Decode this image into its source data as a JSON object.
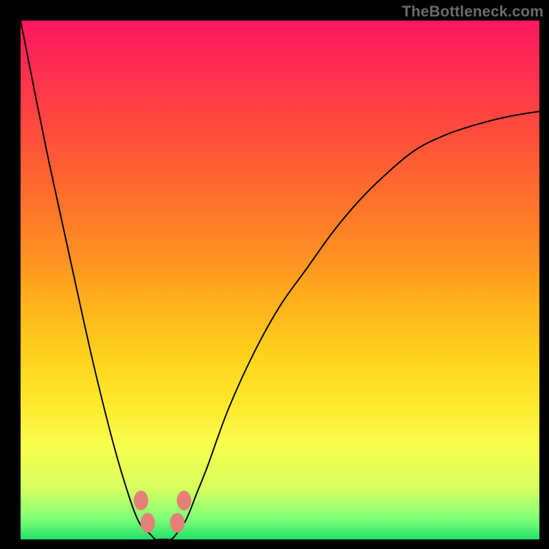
{
  "watermark": "TheBottleneck.com",
  "chart_data": {
    "type": "line",
    "title": "",
    "xlabel": "",
    "ylabel": "",
    "xlim": [
      0,
      100
    ],
    "ylim": [
      0,
      100
    ],
    "background_gradient": {
      "orientation": "vertical",
      "stops": [
        {
          "pos": 0,
          "color": "#ff1761"
        },
        {
          "pos": 8,
          "color": "#ff2b55"
        },
        {
          "pos": 18,
          "color": "#ff4341"
        },
        {
          "pos": 32,
          "color": "#ff6a2e"
        },
        {
          "pos": 45,
          "color": "#ff8f22"
        },
        {
          "pos": 55,
          "color": "#ffb31c"
        },
        {
          "pos": 65,
          "color": "#ffd31e"
        },
        {
          "pos": 75,
          "color": "#feec2f"
        },
        {
          "pos": 82,
          "color": "#f8ff4f"
        },
        {
          "pos": 90,
          "color": "#d8ff5e"
        },
        {
          "pos": 96,
          "color": "#80ff78"
        },
        {
          "pos": 100,
          "color": "#22e06a"
        }
      ]
    },
    "series": [
      {
        "name": "bottleneck-curve",
        "color": "#000000",
        "stroke_width": 2,
        "x": [
          0,
          5,
          10,
          14,
          18,
          21,
          23,
          25,
          26,
          27,
          28,
          29,
          30,
          32,
          34,
          36,
          40,
          45,
          50,
          55,
          60,
          65,
          70,
          76,
          82,
          88,
          94,
          100
        ],
        "values": [
          100,
          75,
          52,
          34,
          18,
          8,
          3,
          1,
          0,
          0,
          0,
          0,
          1,
          4,
          9,
          14,
          25,
          36,
          45,
          52,
          59,
          65,
          70,
          75,
          78,
          80,
          81.5,
          82.5
        ]
      }
    ],
    "markers": [
      {
        "name": "marker-left-upper",
        "x": 23.2,
        "y": 7.5,
        "color": "#e68076",
        "r": 1.4
      },
      {
        "name": "marker-left-lower",
        "x": 24.5,
        "y": 3.2,
        "color": "#e68076",
        "r": 1.4
      },
      {
        "name": "marker-right-lower",
        "x": 30.2,
        "y": 3.2,
        "color": "#e68076",
        "r": 1.4
      },
      {
        "name": "marker-right-upper",
        "x": 31.5,
        "y": 7.5,
        "color": "#e68076",
        "r": 1.4
      }
    ]
  }
}
